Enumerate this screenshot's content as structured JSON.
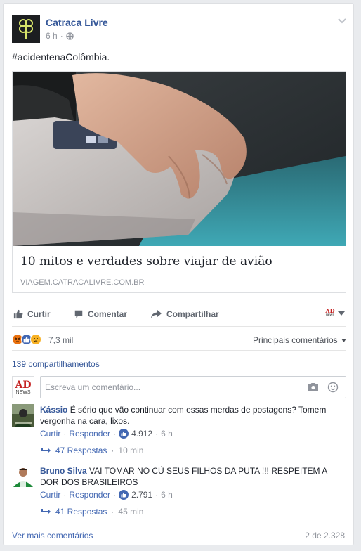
{
  "post": {
    "page_name": "Catraca Livre",
    "time": "6 h",
    "meta_separator": "·",
    "text": "#acidentenaColômbia.",
    "link": {
      "title": "10 mitos e verdades sobre viajar de avião",
      "domain": "VIAGEM.CATRACALIVRE.COM.BR"
    }
  },
  "actions": {
    "like": "Curtir",
    "comment": "Comentar",
    "share": "Compartilhar"
  },
  "page_avatar": {
    "line1": "AD",
    "line2": "NEWS"
  },
  "reactions": {
    "count": "7,3 mil",
    "sort_label": "Principais comentários",
    "icons": [
      "angry-icon",
      "like-icon",
      "sad-icon"
    ],
    "colors": {
      "angry": "#e9710f",
      "like": "#4267b2",
      "sad": "#f7b125"
    }
  },
  "shares": "139 compartilhamentos",
  "composer": {
    "placeholder": "Escreva um comentário...",
    "avatar": {
      "line1": "AD",
      "line2": "NEWS"
    }
  },
  "comments": [
    {
      "author": "Kássio",
      "text": "É sério que vão continuar com essas merdas de postagens? Tomem vergonha na cara, lixos.",
      "like_label": "Curtir",
      "reply_label": "Responder",
      "likes": "4.912",
      "time": "6 h",
      "replies": "47 Respostas",
      "replies_time": "10 min"
    },
    {
      "author": "Bruno Silva",
      "text": "VAI TOMAR NO CÚ SEUS FILHOS DA PUTA !!! RESPEITEM A DOR DOS BRASILEIROS",
      "like_label": "Curtir",
      "reply_label": "Responder",
      "likes": "2.791",
      "time": "6 h",
      "replies": "41 Respostas",
      "replies_time": "45 min"
    }
  ],
  "footer": {
    "more": "Ver mais comentários",
    "pagination": "2 de 2.328"
  }
}
